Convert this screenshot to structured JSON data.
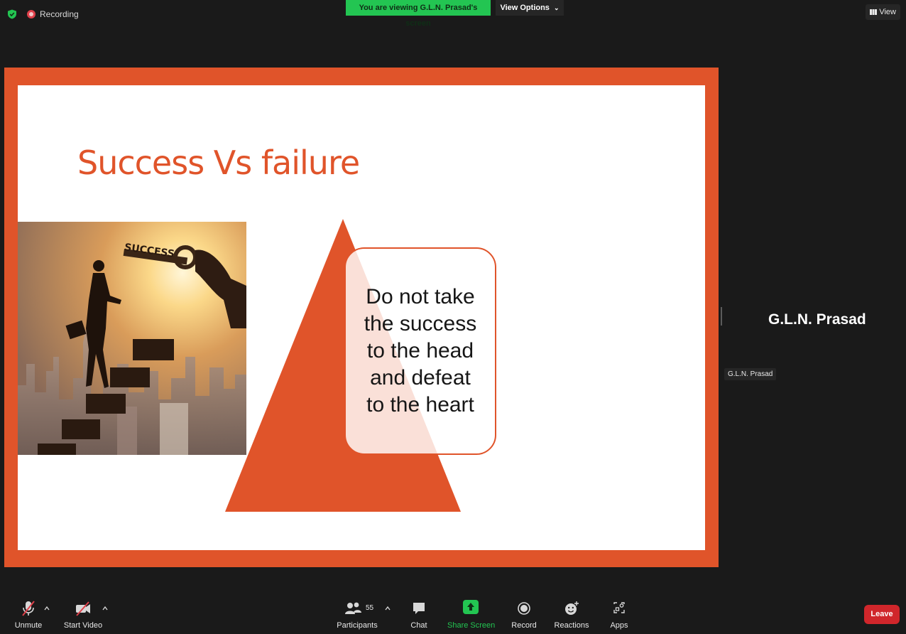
{
  "topbar": {
    "recording_label": "Recording",
    "viewing_banner": "You are viewing G.L.N. Prasad's screen",
    "view_options_label": "View Options",
    "view_button_label": "View"
  },
  "slide": {
    "title": "Success Vs failure",
    "photo_caption": "SUCCESS",
    "callout_lines": [
      "Do not take",
      "the success",
      "to the head",
      "and defeat",
      "to the heart"
    ]
  },
  "participant": {
    "name_large": "G.L.N. Prasad",
    "name_tag": "G.L.N. Prasad"
  },
  "toolbar": {
    "unmute": "Unmute",
    "start_video": "Start Video",
    "participants": "Participants",
    "participant_count": "55",
    "chat": "Chat",
    "share_screen": "Share Screen",
    "record": "Record",
    "reactions": "Reactions",
    "apps": "Apps",
    "leave": "Leave"
  },
  "colors": {
    "accent_orange": "#e0542a",
    "share_green": "#23c552",
    "leave_red": "#d0262b",
    "background": "#1a1a1a"
  }
}
